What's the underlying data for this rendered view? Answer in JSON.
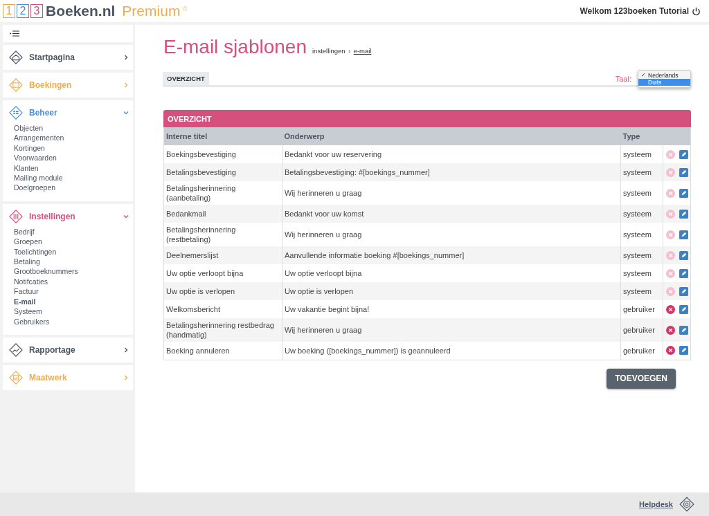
{
  "logo": {
    "digits": [
      {
        "text": "1",
        "color": "#e8a94a"
      },
      {
        "text": "2",
        "color": "#4a90d9"
      },
      {
        "text": "3",
        "color": "#d6507e"
      }
    ],
    "name": "Boeken.nl",
    "tier": "Premium",
    "star": "☆"
  },
  "welcome": "Welkom 123boeken Tutorial",
  "sidebar": [
    {
      "label": "Startpagina",
      "color": "#4a5563",
      "expanded": false
    },
    {
      "label": "Boekingen",
      "color": "#f0ad4e",
      "expanded": false
    },
    {
      "label": "Beheer",
      "color": "#4a90d9",
      "expanded": true,
      "children": [
        {
          "label": "Objecten",
          "selected": false
        },
        {
          "label": "Arrangementen",
          "selected": false
        },
        {
          "label": "Kortingen",
          "selected": false
        },
        {
          "label": "Voorwaarden",
          "selected": false
        },
        {
          "label": "Klanten",
          "selected": false
        },
        {
          "label": "Mailing module",
          "selected": false
        },
        {
          "label": "Doelgroepen",
          "selected": false
        }
      ]
    },
    {
      "label": "Instellingen",
      "color": "#d6507e",
      "expanded": true,
      "children": [
        {
          "label": "Bedrijf",
          "selected": false
        },
        {
          "label": "Groepen",
          "selected": false
        },
        {
          "label": "Toelichtingen",
          "selected": false
        },
        {
          "label": "Betaling",
          "selected": false
        },
        {
          "label": "Grootboeknummers",
          "selected": false
        },
        {
          "label": "Notifcaties",
          "selected": false
        },
        {
          "label": "Factuur",
          "selected": false
        },
        {
          "label": "E-mail",
          "selected": true
        },
        {
          "label": "Systeem",
          "selected": false
        },
        {
          "label": "Gebruikers",
          "selected": false
        }
      ]
    },
    {
      "label": "Rapportage",
      "color": "#4a5563",
      "expanded": false
    },
    {
      "label": "Maatwerk",
      "color": "#f0ad4e",
      "expanded": false
    }
  ],
  "page": {
    "title": "E-mail sjablonen",
    "breadcrumb": [
      "instellingen",
      "›",
      "e-mail"
    ]
  },
  "tabs": [
    {
      "label": "OVERZICHT",
      "selected": true
    }
  ],
  "language": {
    "label": "Taal:",
    "check_mark": "✓",
    "options": [
      {
        "label": "Nederlands",
        "checked": true,
        "highlighted": false
      },
      {
        "label": "Duits",
        "checked": false,
        "highlighted": true
      }
    ]
  },
  "table": {
    "title": "OVERZICHT",
    "columns": [
      "Interne titel",
      "Onderwerp",
      "Type"
    ],
    "rows": [
      {
        "title": "Boekingsbevestiging",
        "subject": "Bedankt voor uw reservering",
        "type": "systeem",
        "delete_disabled": true
      },
      {
        "title": "Betalingsbevestiging",
        "subject": "Betalingsbevestiging: #[boekings_nummer]",
        "type": "systeem",
        "delete_disabled": true
      },
      {
        "title": "Betalingsherinnering (aanbetaling)",
        "subject": "Wij herinneren u graag",
        "type": "systeem",
        "delete_disabled": true
      },
      {
        "title": "Bedankmail",
        "subject": "Bedankt voor uw komst",
        "type": "systeem",
        "delete_disabled": true
      },
      {
        "title": "Betalingsherinnering (restbetaling)",
        "subject": "Wij herinneren u graag",
        "type": "systeem",
        "delete_disabled": true
      },
      {
        "title": "Deelnemerslijst",
        "subject": "Aanvullende informatie boeking #[boekings_nummer]",
        "type": "systeem",
        "delete_disabled": true
      },
      {
        "title": "Uw optie verloopt bijna",
        "subject": "Uw optie verloopt bijna",
        "type": "systeem",
        "delete_disabled": true
      },
      {
        "title": "Uw optie is verlopen",
        "subject": "Uw optie is verlopen",
        "type": "systeem",
        "delete_disabled": true
      },
      {
        "title": "Welkomsbericht",
        "subject": "Uw vakantie begint bijna!",
        "type": "gebruiker",
        "delete_disabled": false
      },
      {
        "title": "Betalingsherinnering restbedrag (handmatig)",
        "subject": "Wij herinneren u graag",
        "type": "gebruiker",
        "delete_disabled": false
      },
      {
        "title": "Boeking annuleren",
        "subject": "Uw boeking ([boekings_nummer]) is geannuleerd",
        "type": "gebruiker",
        "delete_disabled": false
      }
    ]
  },
  "add_button": "TOEVOEGEN",
  "footer": {
    "helpdesk": "Helpdesk"
  }
}
